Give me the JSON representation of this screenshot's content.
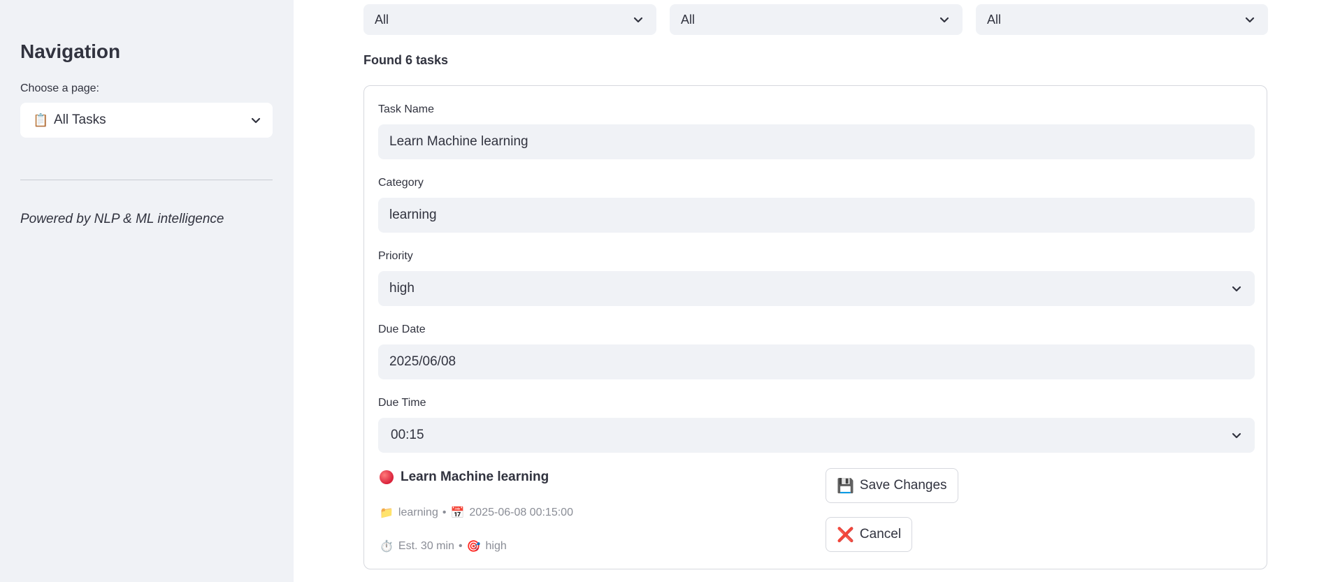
{
  "sidebar": {
    "title": "Navigation",
    "page_label": "Choose a page:",
    "page_select": {
      "icon": "📋",
      "value": "All Tasks"
    },
    "footer": "Powered by NLP & ML intelligence"
  },
  "filters": [
    {
      "value": "All"
    },
    {
      "value": "All"
    },
    {
      "value": "All"
    }
  ],
  "results": {
    "found_text": "Found 6 tasks"
  },
  "task_form": {
    "task_name": {
      "label": "Task Name",
      "value": "Learn Machine learning"
    },
    "category": {
      "label": "Category",
      "value": "learning"
    },
    "priority": {
      "label": "Priority",
      "value": "high"
    },
    "due_date": {
      "label": "Due Date",
      "value": "2025/06/08"
    },
    "due_time": {
      "label": "Due Time",
      "value": "00:15"
    }
  },
  "task_summary": {
    "title": "Learn Machine learning",
    "category_icon": "📁",
    "category": "learning",
    "calendar_icon": "📅",
    "due": "2025-06-08 00:15:00",
    "timer_icon": "⏱️",
    "estimate": "Est. 30 min",
    "target_icon": "🎯",
    "priority": "high",
    "separator": "•"
  },
  "actions": {
    "save": {
      "icon": "💾",
      "label": "Save Changes"
    },
    "cancel": {
      "icon": "❌",
      "label": "Cancel"
    }
  },
  "colors": {
    "sidebar_bg": "#f0f2f6",
    "input_bg": "#f0f2f6",
    "text": "#31333f",
    "muted": "#8a8d96",
    "priority_high": "#d9213a"
  }
}
